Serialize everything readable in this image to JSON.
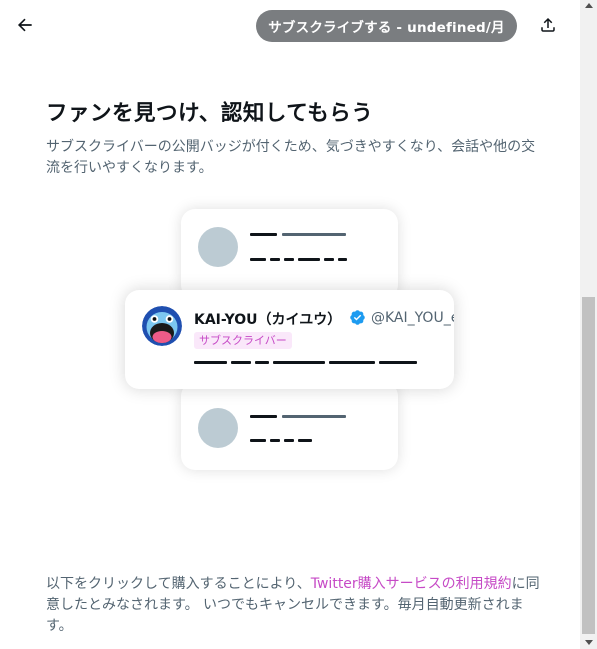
{
  "header": {
    "subscribe_button_label": "サブスクライブする - undefined/月",
    "back_icon": "arrow-left-icon",
    "share_icon": "share-upload-icon",
    "pill_color": "#7a7d80"
  },
  "main": {
    "headline": "ファンを見つけ、認知してもらう",
    "description": "サブスクライバーの公開バッジが付くため、気づきやすくなり、会話や他の交流を行いやすくなります。"
  },
  "preview": {
    "name": "KAI-YOU（カイユウ）",
    "handle": "@KAI_YOU_e",
    "badge_label": "サブスクライバー",
    "verified_icon": "verified-badge-icon",
    "avatar_icon": "kai-you-logo-icon",
    "verified_color": "#1d9bf0",
    "badge_color": "#c64ac6"
  },
  "legal": {
    "text_before": "以下をクリックして購入することにより、",
    "link_text": "Twitter購入サービスの利用規約",
    "text_after": "に同意したとみなされます。 いつでもキャンセルできます。毎月自動更新されます。",
    "link_color": "#c64ac6"
  }
}
